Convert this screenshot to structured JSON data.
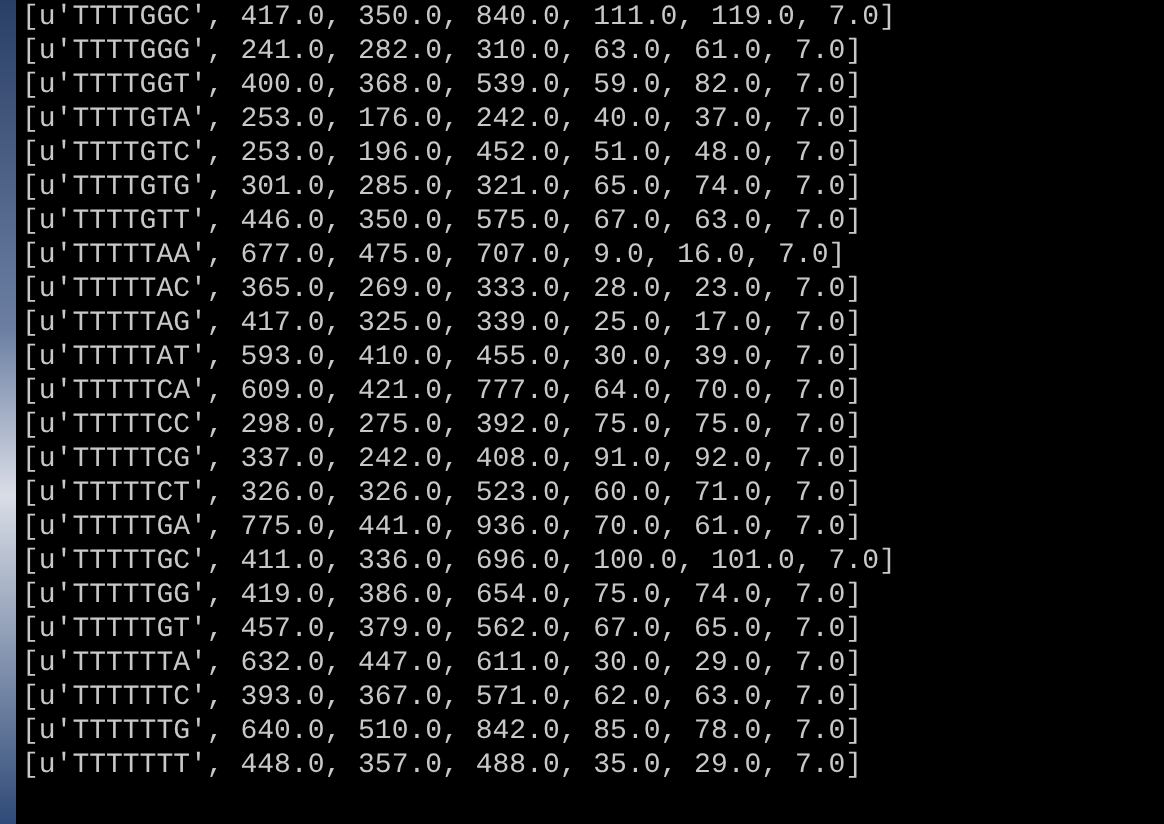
{
  "console": {
    "lines": [
      "[u'TTTTGGC', 417.0, 350.0, 840.0, 111.0, 119.0, 7.0]",
      "[u'TTTTGGG', 241.0, 282.0, 310.0, 63.0, 61.0, 7.0]",
      "[u'TTTTGGT', 400.0, 368.0, 539.0, 59.0, 82.0, 7.0]",
      "[u'TTTTGTA', 253.0, 176.0, 242.0, 40.0, 37.0, 7.0]",
      "[u'TTTTGTC', 253.0, 196.0, 452.0, 51.0, 48.0, 7.0]",
      "[u'TTTTGTG', 301.0, 285.0, 321.0, 65.0, 74.0, 7.0]",
      "[u'TTTTGTT', 446.0, 350.0, 575.0, 67.0, 63.0, 7.0]",
      "[u'TTTTTAA', 677.0, 475.0, 707.0, 9.0, 16.0, 7.0]",
      "[u'TTTTTAC', 365.0, 269.0, 333.0, 28.0, 23.0, 7.0]",
      "[u'TTTTTAG', 417.0, 325.0, 339.0, 25.0, 17.0, 7.0]",
      "[u'TTTTTAT', 593.0, 410.0, 455.0, 30.0, 39.0, 7.0]",
      "[u'TTTTTCA', 609.0, 421.0, 777.0, 64.0, 70.0, 7.0]",
      "[u'TTTTTCC', 298.0, 275.0, 392.0, 75.0, 75.0, 7.0]",
      "[u'TTTTTCG', 337.0, 242.0, 408.0, 91.0, 92.0, 7.0]",
      "[u'TTTTTCT', 326.0, 326.0, 523.0, 60.0, 71.0, 7.0]",
      "[u'TTTTTGA', 775.0, 441.0, 936.0, 70.0, 61.0, 7.0]",
      "[u'TTTTTGC', 411.0, 336.0, 696.0, 100.0, 101.0, 7.0]",
      "[u'TTTTTGG', 419.0, 386.0, 654.0, 75.0, 74.0, 7.0]",
      "[u'TTTTTGT', 457.0, 379.0, 562.0, 67.0, 65.0, 7.0]",
      "[u'TTTTTTA', 632.0, 447.0, 611.0, 30.0, 29.0, 7.0]",
      "[u'TTTTTTC', 393.0, 367.0, 571.0, 62.0, 63.0, 7.0]",
      "[u'TTTTTTG', 640.0, 510.0, 842.0, 85.0, 78.0, 7.0]",
      "[u'TTTTTTT', 448.0, 357.0, 488.0, 35.0, 29.0, 7.0]"
    ]
  }
}
